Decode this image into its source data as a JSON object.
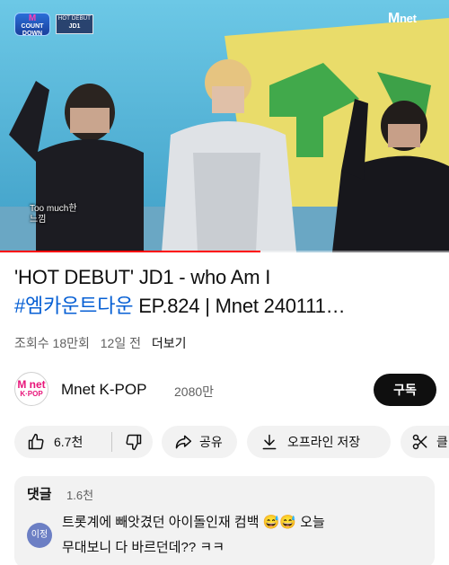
{
  "player": {
    "badge_logo_line1": "M",
    "badge_logo_line2": "COUNT",
    "badge_logo_line3": "DOWN",
    "hot_debut_label": "HOT DEBUT",
    "hot_debut_artist": "JD1",
    "channel_bug": "M",
    "channel_bug_suffix": "net",
    "subtitle": "Too much한\n느낌",
    "progress_fraction": 0.58,
    "colors": {
      "progress": "#ff0000",
      "stage_sky": "#4fb6d8"
    }
  },
  "video": {
    "title_line1": "'HOT DEBUT' JD1 - who Am I",
    "title_hashtag": "#엠카운트다운",
    "title_line2_rest": " EP.824 | Mnet 240111…",
    "views": "조회수 18만회",
    "age": "12일 전",
    "more": "더보기"
  },
  "channel": {
    "avatar_line1": "M net",
    "avatar_line2": "K·POP",
    "name": "Mnet K-POP",
    "subscribers": "2080만",
    "subscribe_label": "구독"
  },
  "actions": {
    "like_count": "6.7천",
    "share_label": "공유",
    "offline_label": "오프라인 저장",
    "clip_label": "클립",
    "icons": [
      "thumbs-up-icon",
      "thumbs-down-icon",
      "share-icon",
      "download-icon",
      "scissors-icon"
    ]
  },
  "comments": {
    "header": "댓글",
    "count": "1.6천",
    "avatar_text": "이정",
    "text_line1": "트롯계에 빼앗겼던 아이돌인재 컴백 😅😅 오늘",
    "text_line2": "무대보니 다 바르던데?? ㅋㅋ"
  }
}
